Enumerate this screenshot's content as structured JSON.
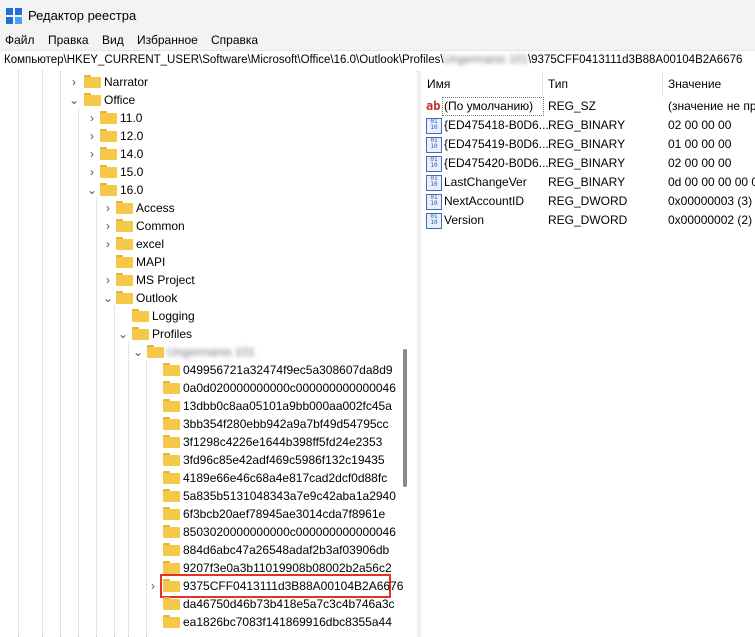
{
  "window": {
    "title": "Редактор реестра"
  },
  "menu": [
    "Файл",
    "Правка",
    "Вид",
    "Избранное",
    "Справка"
  ],
  "address": {
    "prefix": "Компьютер\\HKEY_CURRENT_USER\\Software\\Microsoft\\Office\\16.0\\Outlook\\Profiles\\",
    "hidden": "Ungermanis 101",
    "suffix": "\\9375CFF0413111d3B88A00104B2A6676"
  },
  "tree": {
    "narrator": "Narrator",
    "office": "Office",
    "versions": [
      "11.0",
      "12.0",
      "14.0",
      "15.0",
      "16.0"
    ],
    "v16_children": [
      "Access",
      "Common",
      "excel",
      "MAPI",
      "MS Project",
      "Outlook"
    ],
    "outlook_children": [
      "Logging",
      "Profiles"
    ],
    "profile_name": "Ungermanis 101",
    "keys": [
      "049956721a32474f9ec5a308607da8d9",
      "0a0d020000000000c000000000000046",
      "13dbb0c8aa05101a9bb000aa002fc45a",
      "3bb354f280ebb942a9a7bf49d54795cc",
      "3f1298c4226e1644b398ff5fd24e2353",
      "3fd96c85e42adf469c5986f132c19435",
      "4189e66e46c68a4e817cad2dcf0d88fc",
      "5a835b5131048343a7e9c42aba1a2940",
      "6f3bcb20aef78945ae3014cda7f8961e",
      "8503020000000000c000000000000046",
      "884d6abc47a26548adaf2b3af03906db",
      "9207f3e0a3b11019908b08002b2a56c2",
      "9375CFF0413111d3B88A00104B2A6676",
      "da46750d46b73b418e5a7c3c4b746a3c",
      "ea1826bc7083f141869916dbc8355a44"
    ],
    "selected": "9375CFF0413111d3B88A00104B2A6676"
  },
  "values": {
    "headers": {
      "name": "Имя",
      "type": "Тип",
      "data": "Значение"
    },
    "rows": [
      {
        "icon": "string-value-icon",
        "name": "(По умолчанию)",
        "type": "REG_SZ",
        "data": "(значение не пр"
      },
      {
        "icon": "binary-value-icon",
        "name": "{ED475418-B0D6...",
        "type": "REG_BINARY",
        "data": "02 00 00 00"
      },
      {
        "icon": "binary-value-icon",
        "name": "{ED475419-B0D6...",
        "type": "REG_BINARY",
        "data": "01 00 00 00"
      },
      {
        "icon": "binary-value-icon",
        "name": "{ED475420-B0D6...",
        "type": "REG_BINARY",
        "data": "02 00 00 00"
      },
      {
        "icon": "binary-value-icon",
        "name": "LastChangeVer",
        "type": "REG_BINARY",
        "data": "0d 00 00 00 00 00"
      },
      {
        "icon": "binary-value-icon",
        "name": "NextAccountID",
        "type": "REG_DWORD",
        "data": "0x00000003 (3)"
      },
      {
        "icon": "binary-value-icon",
        "name": "Version",
        "type": "REG_DWORD",
        "data": "0x00000002 (2)"
      }
    ]
  },
  "colors": {
    "folder": "#f5c84a",
    "highlight": "#e2332a",
    "chrome": "#f3f3f3"
  }
}
